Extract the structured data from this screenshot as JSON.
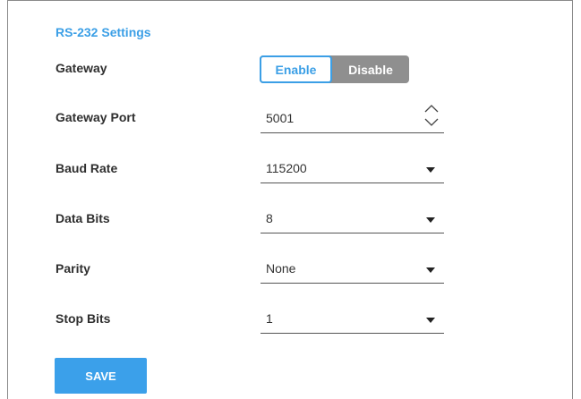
{
  "section_title": "RS-232 Settings",
  "gateway": {
    "label": "Gateway",
    "options": [
      "Enable",
      "Disable"
    ],
    "selected": "Enable"
  },
  "gateway_port": {
    "label": "Gateway Port",
    "value": "5001"
  },
  "baud_rate": {
    "label": "Baud Rate",
    "value": "115200"
  },
  "data_bits": {
    "label": "Data Bits",
    "value": "8"
  },
  "parity": {
    "label": "Parity",
    "value": "None"
  },
  "stop_bits": {
    "label": "Stop Bits",
    "value": "1"
  },
  "save_label": "SAVE",
  "colors": {
    "accent": "#3b9fe6",
    "toggle_inactive": "#8f8f8f"
  }
}
